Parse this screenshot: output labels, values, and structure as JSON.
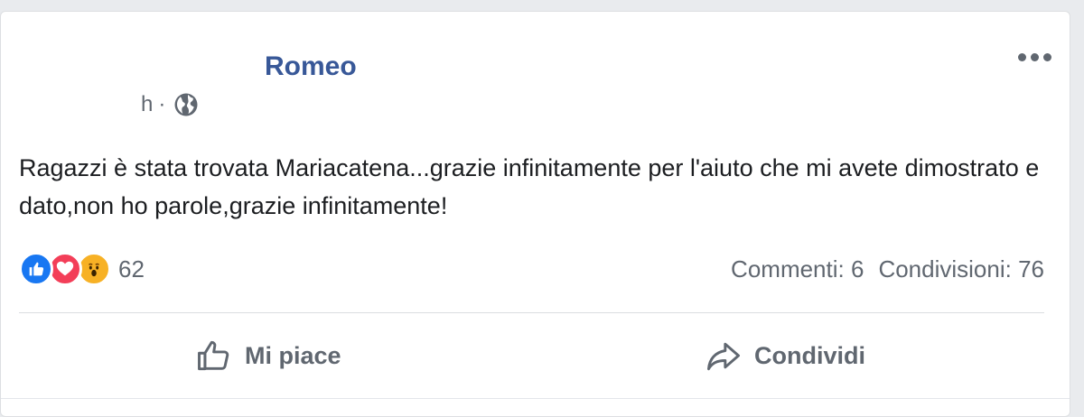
{
  "post": {
    "author_name": "Romeo",
    "timestamp": "h",
    "separator": "·",
    "audience_icon": "globe-icon",
    "more_options_icon": "more-options-icon",
    "text": "Ragazzi è stata trovata Mariacatena...grazie infinitamente per l'aiuto che mi avete dimostrato e dato,non ho parole,grazie infinitamente!"
  },
  "reactions": {
    "icons": [
      "like-reaction-icon",
      "love-reaction-icon",
      "wow-reaction-icon"
    ],
    "count": "62"
  },
  "stats": {
    "comments": "Commenti: 6",
    "shares": "Condivisioni: 76"
  },
  "actions": {
    "like_label": "Mi piace",
    "share_label": "Condividi"
  },
  "colors": {
    "author": "#385898",
    "like": "#1877f2",
    "love": "#f33e58",
    "wow": "#f7b125",
    "secondary_text": "#606770"
  }
}
